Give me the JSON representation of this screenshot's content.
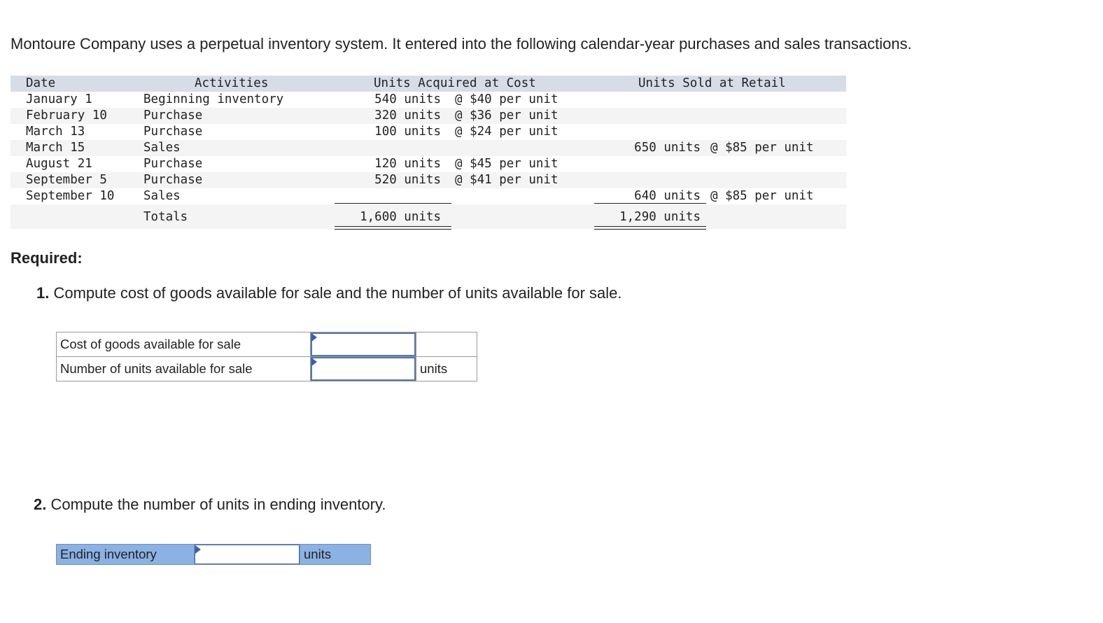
{
  "intro": "Montoure Company uses a perpetual inventory system. It entered into the following calendar-year purchases and sales transactions.",
  "table": {
    "headers": {
      "date": "Date",
      "activities": "Activities",
      "acquired": "Units Acquired at Cost",
      "sold": "Units Sold at Retail"
    },
    "rows": [
      {
        "date": "January 1",
        "activity": "Beginning inventory",
        "acq_units": "540 units",
        "acq_price": "@ $40 per unit",
        "sold_units": "",
        "sold_price": ""
      },
      {
        "date": "February 10",
        "activity": "Purchase",
        "acq_units": "320 units",
        "acq_price": "@ $36 per unit",
        "sold_units": "",
        "sold_price": ""
      },
      {
        "date": "March 13",
        "activity": "Purchase",
        "acq_units": "100 units",
        "acq_price": "@ $24 per unit",
        "sold_units": "",
        "sold_price": ""
      },
      {
        "date": "March 15",
        "activity": "Sales",
        "acq_units": "",
        "acq_price": "",
        "sold_units": "650 units",
        "sold_price": "@ $85 per unit"
      },
      {
        "date": "August 21",
        "activity": "Purchase",
        "acq_units": "120 units",
        "acq_price": "@ $45 per unit",
        "sold_units": "",
        "sold_price": ""
      },
      {
        "date": "September 5",
        "activity": "Purchase",
        "acq_units": "520 units",
        "acq_price": "@ $41 per unit",
        "sold_units": "",
        "sold_price": ""
      },
      {
        "date": "September 10",
        "activity": "Sales",
        "acq_units": "",
        "acq_price": "",
        "sold_units": "640 units",
        "sold_price": "@ $85 per unit"
      }
    ],
    "totals": {
      "label": "Totals",
      "acq_units": "1,600 units",
      "sold_units": "1,290 units"
    }
  },
  "required_label": "Required:",
  "q1": {
    "number": "1.",
    "text": "Compute cost of goods available for sale and the number of units available for sale.",
    "rows": [
      {
        "label": "Cost of goods available for sale",
        "value": "",
        "unit": ""
      },
      {
        "label": "Number of units available for sale",
        "value": "",
        "unit": "units"
      }
    ]
  },
  "q2": {
    "number": "2.",
    "text": "Compute the number of units in ending inventory.",
    "row": {
      "label": "Ending inventory",
      "value": "",
      "unit": "units"
    }
  },
  "colors": {
    "header_bg": "#d7dde6",
    "input_border": "#5576a8",
    "answer_fill": "#8cb1e3"
  }
}
